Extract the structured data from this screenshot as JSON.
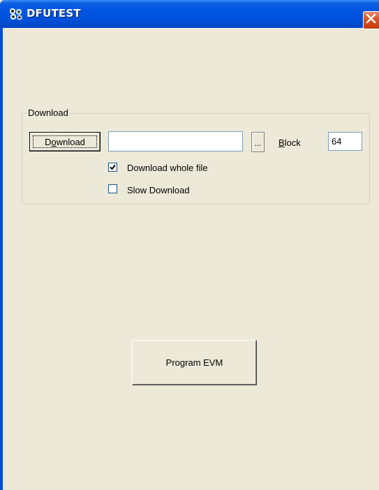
{
  "window": {
    "title": "DFUTEST"
  },
  "download_group": {
    "label": "Download",
    "download_button": {
      "label_pre": "D",
      "label_accel": "o",
      "label_post": "wnload"
    },
    "file_path": {
      "value": "",
      "placeholder": ""
    },
    "browse_button_label": "...",
    "block": {
      "label_accel": "B",
      "label_rest": "lock",
      "value": "64"
    },
    "download_whole_file": {
      "label": "Download whole file",
      "checked": true
    },
    "slow_download": {
      "label": "Slow Download",
      "checked": false
    }
  },
  "program_evm_button": {
    "label": "Program EVM"
  },
  "colors": {
    "titlebar": "#0054e3",
    "window_bg": "#ece9d8",
    "close_button": "#d9531e"
  },
  "icons": {
    "app_icon": "app-icon",
    "close_icon": "close-icon",
    "checkmark_icon": "checkmark-icon"
  }
}
